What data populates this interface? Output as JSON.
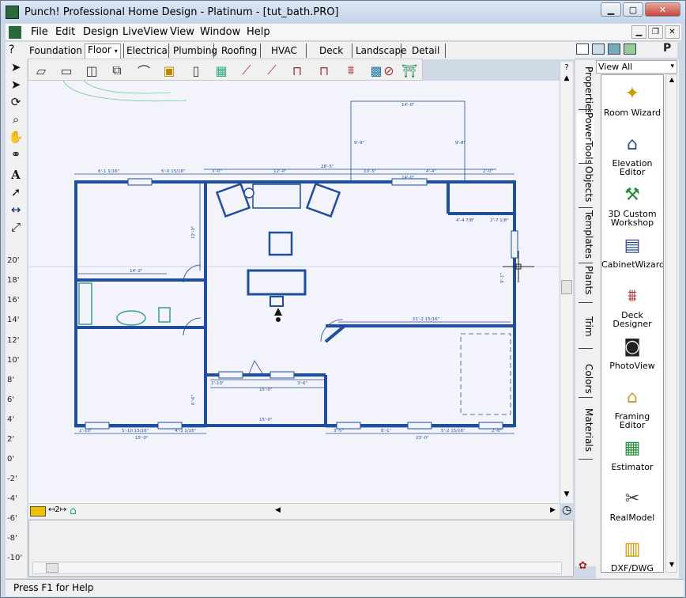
{
  "window": {
    "title": "Punch! Professional Home Design - Platinum - [tut_bath.PRO]"
  },
  "menubar": {
    "items": [
      "File",
      "Edit",
      "Design",
      "LiveView",
      "View",
      "Window",
      "Help"
    ]
  },
  "tabs": [
    "Foundation",
    "Floor",
    "Electrical",
    "Plumbing",
    "Roofing",
    "HVAC",
    "Deck",
    "Landscape",
    "Detail"
  ],
  "ruler": {
    "labels": [
      "20'",
      "18'",
      "16'",
      "14'",
      "12'",
      "10'",
      "8'",
      "6'",
      "4'",
      "2'",
      "0'",
      "-2'",
      "-4'",
      "-6'",
      "-8'",
      "-10'"
    ]
  },
  "plan": {
    "dims": {
      "top_a": "6'-1 1/16\"",
      "top_b": "5'-0 15/16\"",
      "top_c": "3'-0\"",
      "top_d": "12'-0\"",
      "top_e": "10'-5\"",
      "top_f": "4'-4\"",
      "top_g": "2'-0\"",
      "overall": "28'-5\"",
      "ext_w": "14'-0\"",
      "ext_wall": "14'-0\"",
      "ext_side_l": "9'-9\"",
      "ext_side_r": "9'-8\"",
      "left_h": "14'-2\"",
      "right_h": "21'-2 15/16\"",
      "mid_h1": "15'-0\"",
      "mid_h2": "15'-0\"",
      "b_l1": "2'-10\"",
      "b_l2": "5'-10 15/16\"",
      "b_l3": "4'-3 1/16\"",
      "b_l_total": "15'-0\"",
      "b_r1": "3'-5\"",
      "b_r2": "8'-1\"",
      "b_r3": "5'-2 15/16\"",
      "b_r4": "2'-8\"",
      "b_r_total": "23'-0\"",
      "closet_a": "4'-4 7/8\"",
      "closet_b": "2'-7 1/8\"",
      "hall_a": "2'-10\"",
      "hall_b": "3'-6\"",
      "v1": "12'-0\"",
      "v2": "9'-1\"",
      "v3": "6'-6\""
    }
  },
  "rightpanel": {
    "filter": "View All",
    "vtabs": [
      "Properties",
      "PowerTools",
      "Objects",
      "Templates",
      "Plants",
      "Trim",
      "Colors",
      "Materials"
    ],
    "tools": [
      {
        "label": "Room Wizard",
        "icon": "wand-icon"
      },
      {
        "label": "Elevation Editor",
        "icon": "house-icon"
      },
      {
        "label": "3D Custom Workshop",
        "icon": "workshop-icon"
      },
      {
        "label": "CabinetWizard",
        "icon": "cabinet-icon"
      },
      {
        "label": "Deck Designer",
        "icon": "deck-icon"
      },
      {
        "label": "PhotoView",
        "icon": "camera-icon"
      },
      {
        "label": "Framing Editor",
        "icon": "framing-icon"
      },
      {
        "label": "Estimator",
        "icon": "calculator-icon"
      },
      {
        "label": "RealModel",
        "icon": "realmodel-icon"
      },
      {
        "label": "DXF/DWG",
        "icon": "dxf-icon"
      }
    ]
  },
  "status": {
    "text": "Press F1 for Help"
  },
  "colors": {
    "wall": "#1f4e9a",
    "canvas": "#f3f3fb",
    "accent": "#2b4d86"
  }
}
